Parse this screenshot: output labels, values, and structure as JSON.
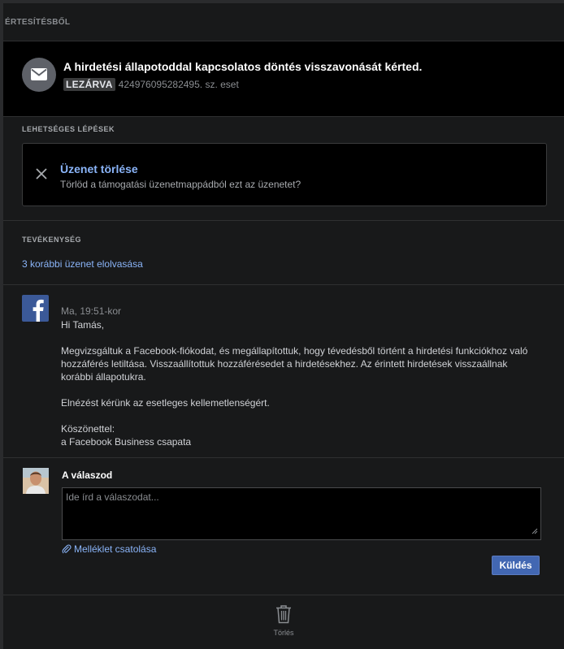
{
  "header": {
    "title": "ÉRTESÍTÉSBŐL"
  },
  "case": {
    "icon": "envelope-icon",
    "title": "A hirdetési állapotoddal kapcsolatos döntés visszavonását kérted.",
    "status_badge": "LEZÁRVA",
    "case_number": "424976095282495. sz. eset"
  },
  "steps": {
    "label": "LEHETSÉGES LÉPÉSEK",
    "items": [
      {
        "icon": "close-icon",
        "title": "Üzenet törlése",
        "description": "Törlöd a támogatási üzenetmappádból ezt az üzenetet?"
      }
    ]
  },
  "activity": {
    "label": "TEVÉKENYSÉG",
    "previous_messages_link": "3 korábbi üzenet elolvasása"
  },
  "message": {
    "sender_icon": "facebook-logo-icon",
    "time": "Ma, 19:51-kor",
    "greeting": "Hi Tamás,",
    "paragraph1_line1": "Megvizsgáltuk a Facebook-fiókodat, és megállapítottuk, hogy tévedésből történt a hirdetési funkciókhoz való",
    "paragraph1_line2": "hozzáférés letiltása. Visszaállítottuk hozzáférésedet a hirdetésekhez. Az érintett hirdetések visszaállnak",
    "paragraph1_line3": "korábbi állapotukra.",
    "paragraph2": "Elnézést kérünk az esetleges kellemetlenségért.",
    "closing": "Köszönettel:",
    "signature": "a Facebook Business csapata"
  },
  "reply": {
    "label": "A válaszod",
    "placeholder": "Ide írd a válaszodat...",
    "attach_label": "Melléklet csatolása",
    "send_label": "Küldés"
  },
  "footer": {
    "delete_label": "Törlés"
  },
  "colors": {
    "link": "#8ab4f8",
    "button": "#4267b2",
    "facebook": "#3b5998"
  }
}
